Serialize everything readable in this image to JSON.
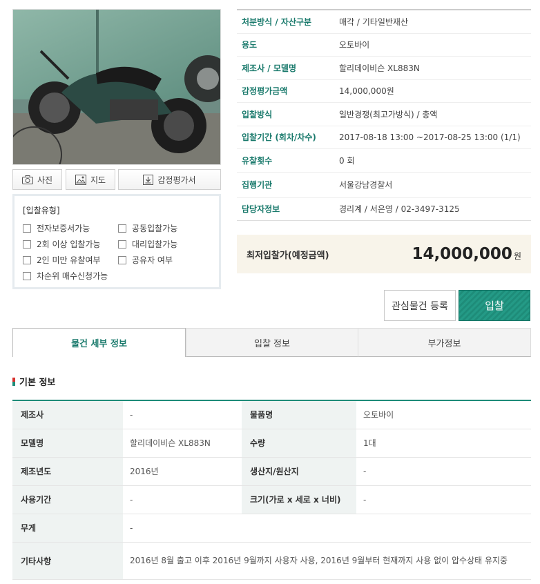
{
  "photo_buttons": {
    "photo": "사진",
    "map": "지도",
    "appraisal": "감정평가서"
  },
  "bid_type": {
    "title": "[입찰유형]",
    "options": [
      "전자보증서가능",
      "공동입찰가능",
      "2회 이상 입찰가능",
      "대리입찰가능",
      "2인 미만 유찰여부",
      "공유자 여부",
      "차순위 매수신청가능"
    ]
  },
  "info": [
    {
      "label": "처분방식 / 자산구분",
      "value": "매각 / 기타일반재산"
    },
    {
      "label": "용도",
      "value": "오토바이"
    },
    {
      "label": "제조사 / 모델명",
      "value": "할리데이비슨 XL883N"
    },
    {
      "label": "감정평가금액",
      "value": "14,000,000원"
    },
    {
      "label": "입찰방식",
      "value": "일반경쟁(최고가방식) / 총액"
    },
    {
      "label": "입찰기간 (회차/차수)",
      "value": "2017-08-18 13:00 ~2017-08-25 13:00 (1/1)"
    },
    {
      "label": "유찰횟수",
      "value": "0 회"
    },
    {
      "label": "집행기관",
      "value": "서울강남경찰서"
    },
    {
      "label": "담당자정보",
      "value": "경리계 / 서은영 / 02-3497-3125"
    }
  ],
  "price": {
    "label": "최저입찰가(예정금액)",
    "amount": "14,000,000",
    "unit": "원"
  },
  "actions": {
    "favorite": "관심물건 등록",
    "bid": "입찰"
  },
  "tabs": [
    "물건 세부 정보",
    "입찰 정보",
    "부가정보"
  ],
  "section": {
    "title": "기본 정보"
  },
  "detail": {
    "rows": [
      {
        "k1": "제조사",
        "v1": "-",
        "k2": "물품명",
        "v2": "오토바이"
      },
      {
        "k1": "모델명",
        "v1": "할리데이비슨 XL883N",
        "k2": "수량",
        "v2": "1대"
      },
      {
        "k1": "제조년도",
        "v1": "2016년",
        "k2": "생산지/원산지",
        "v2": "-"
      },
      {
        "k1": "사용기간",
        "v1": "-",
        "k2": "크기(가로 x 세로 x 너비)",
        "v2": "-"
      }
    ],
    "weight": {
      "k": "무게",
      "v": "-"
    },
    "other": {
      "k": "기타사항",
      "v": "2016년 8월 출고 이후 2016년 9월까지 사용자 사용, 2016년 9월부터 현재까지 사용 없이 압수상태 유지중"
    }
  },
  "colors": {
    "accent": "#1e8c79",
    "label_text": "#1a7a6c",
    "price_bg": "#f8f4ea"
  }
}
